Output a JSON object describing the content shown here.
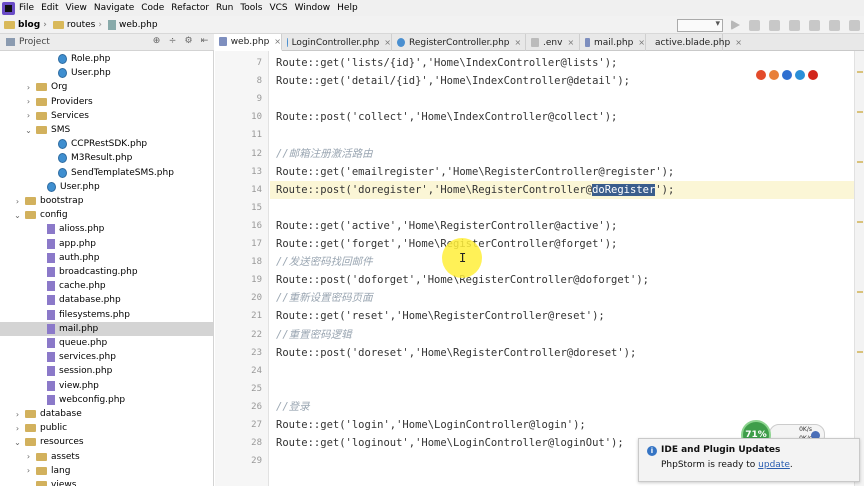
{
  "menubar": {
    "items": [
      "File",
      "Edit",
      "View",
      "Navigate",
      "Code",
      "Refactor",
      "Run",
      "Tools",
      "VCS",
      "Window",
      "Help"
    ]
  },
  "breadcrumb": [
    "blog",
    "routes",
    "web.php"
  ],
  "project_panel": {
    "title": "Project",
    "tools": [
      "⊕",
      "÷",
      "⚙",
      "⇤"
    ]
  },
  "tree": [
    {
      "label": "Role.php",
      "depth": 4,
      "kind": "cphp",
      "arrow": ""
    },
    {
      "label": "User.php",
      "depth": 4,
      "kind": "cphp",
      "arrow": ""
    },
    {
      "label": "Org",
      "depth": 2,
      "kind": "fold",
      "arrow": "›"
    },
    {
      "label": "Providers",
      "depth": 2,
      "kind": "fold",
      "arrow": "›"
    },
    {
      "label": "Services",
      "depth": 2,
      "kind": "fold",
      "arrow": "›"
    },
    {
      "label": "SMS",
      "depth": 2,
      "kind": "fold",
      "arrow": "⌄"
    },
    {
      "label": "CCPRestSDK.php",
      "depth": 4,
      "kind": "cphp",
      "arrow": ""
    },
    {
      "label": "M3Result.php",
      "depth": 4,
      "kind": "cphp",
      "arrow": ""
    },
    {
      "label": "SendTemplateSMS.php",
      "depth": 4,
      "kind": "cphp",
      "arrow": ""
    },
    {
      "label": "User.php",
      "depth": 3,
      "kind": "cphp",
      "arrow": ""
    },
    {
      "label": "bootstrap",
      "depth": 1,
      "kind": "fold",
      "arrow": "›"
    },
    {
      "label": "config",
      "depth": 1,
      "kind": "fold",
      "arrow": "⌄"
    },
    {
      "label": "alioss.php",
      "depth": 3,
      "kind": "fphp",
      "arrow": ""
    },
    {
      "label": "app.php",
      "depth": 3,
      "kind": "fphp",
      "arrow": ""
    },
    {
      "label": "auth.php",
      "depth": 3,
      "kind": "fphp",
      "arrow": ""
    },
    {
      "label": "broadcasting.php",
      "depth": 3,
      "kind": "fphp",
      "arrow": ""
    },
    {
      "label": "cache.php",
      "depth": 3,
      "kind": "fphp",
      "arrow": ""
    },
    {
      "label": "database.php",
      "depth": 3,
      "kind": "fphp",
      "arrow": ""
    },
    {
      "label": "filesystems.php",
      "depth": 3,
      "kind": "fphp",
      "arrow": ""
    },
    {
      "label": "mail.php",
      "depth": 3,
      "kind": "fphp",
      "arrow": "",
      "selected": true
    },
    {
      "label": "queue.php",
      "depth": 3,
      "kind": "fphp",
      "arrow": ""
    },
    {
      "label": "services.php",
      "depth": 3,
      "kind": "fphp",
      "arrow": ""
    },
    {
      "label": "session.php",
      "depth": 3,
      "kind": "fphp",
      "arrow": ""
    },
    {
      "label": "view.php",
      "depth": 3,
      "kind": "fphp",
      "arrow": ""
    },
    {
      "label": "webconfig.php",
      "depth": 3,
      "kind": "fphp",
      "arrow": ""
    },
    {
      "label": "database",
      "depth": 1,
      "kind": "fold",
      "arrow": "›"
    },
    {
      "label": "public",
      "depth": 1,
      "kind": "fold",
      "arrow": "›"
    },
    {
      "label": "resources",
      "depth": 1,
      "kind": "fold",
      "arrow": "⌄"
    },
    {
      "label": "assets",
      "depth": 2,
      "kind": "fold",
      "arrow": "›"
    },
    {
      "label": "lang",
      "depth": 2,
      "kind": "fold",
      "arrow": "›"
    },
    {
      "label": "views",
      "depth": 2,
      "kind": "fold",
      "arrow": "⌄"
    }
  ],
  "tabs": [
    {
      "label": "web.php",
      "icon": "f",
      "active": true
    },
    {
      "label": "LoginController.php",
      "icon": "c"
    },
    {
      "label": "RegisterController.php",
      "icon": "c"
    },
    {
      "label": ".env",
      "icon": "env"
    },
    {
      "label": "mail.php",
      "icon": "f"
    },
    {
      "label": "active.blade.php",
      "icon": "blade"
    }
  ],
  "code_lines": [
    {
      "num": "7",
      "text": "Route::get('lists/{id}','Home\\IndexController@lists');"
    },
    {
      "num": "8",
      "text": "Route::get('detail/{id}','Home\\IndexController@detail');"
    },
    {
      "num": "9",
      "text": ""
    },
    {
      "num": "10",
      "text": "Route::post('collect','Home\\IndexController@collect');"
    },
    {
      "num": "11",
      "text": ""
    },
    {
      "num": "12",
      "text": "//邮箱注册激活路由",
      "comment": true
    },
    {
      "num": "13",
      "text": "Route::get('emailregister','Home\\RegisterController@register');"
    },
    {
      "num": "14",
      "text": "Route::post('doregister','Home\\RegisterController@doRegister');",
      "current": true,
      "highlight": "doRegister"
    },
    {
      "num": "15",
      "text": ""
    },
    {
      "num": "16",
      "text": "Route::get('active','Home\\RegisterController@active');"
    },
    {
      "num": "17",
      "text": "Route::get('forget','Home\\RegisterController@forget');"
    },
    {
      "num": "18",
      "text": "//发送密码找回邮件",
      "comment": true
    },
    {
      "num": "19",
      "text": "Route::post('doforget','Home\\RegisterController@doforget');"
    },
    {
      "num": "20",
      "text": "//重新设置密码页面",
      "comment": true
    },
    {
      "num": "21",
      "text": "Route::get('reset','Home\\RegisterController@reset');"
    },
    {
      "num": "22",
      "text": "//重置密码逻辑",
      "comment": true
    },
    {
      "num": "23",
      "text": "Route::post('doreset','Home\\RegisterController@doreset');"
    },
    {
      "num": "24",
      "text": ""
    },
    {
      "num": "25",
      "text": ""
    },
    {
      "num": "26",
      "text": "//登录",
      "comment": true
    },
    {
      "num": "27",
      "text": "Route::get('login','Home\\LoginController@login');"
    },
    {
      "num": "28",
      "text": "Route::get('loginout','Home\\LoginController@loginOut');"
    },
    {
      "num": "29",
      "text": ""
    }
  ],
  "browser_icons": [
    "chrome-icon",
    "firefox-icon",
    "ie-icon",
    "edge-icon",
    "opera-icon"
  ],
  "network": {
    "percent": "71%",
    "down": "0K/s",
    "up": "0K/s"
  },
  "notification": {
    "title": "IDE and Plugin Updates",
    "message": "PhpStorm is ready to ",
    "link": "update",
    "suffix": "."
  }
}
